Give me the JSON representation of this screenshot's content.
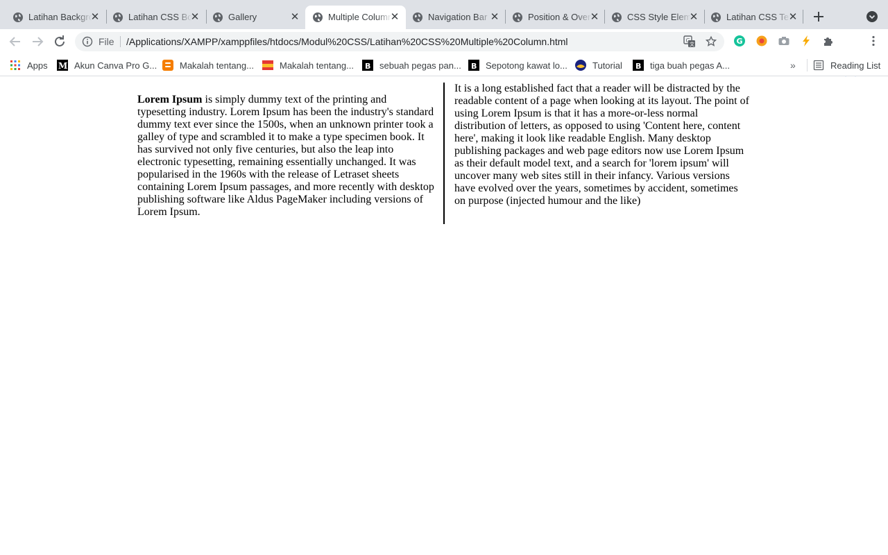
{
  "tabs": [
    {
      "title": "Latihan Background",
      "active": false
    },
    {
      "title": "Latihan CSS Border",
      "active": false
    },
    {
      "title": "Gallery",
      "active": false
    },
    {
      "title": "Multiple Column",
      "active": true
    },
    {
      "title": "Navigation Bar",
      "active": false
    },
    {
      "title": "Position & Overflow",
      "active": false
    },
    {
      "title": "CSS Style Element",
      "active": false
    },
    {
      "title": "Latihan CSS Text",
      "active": false
    }
  ],
  "omnibox": {
    "scheme_label": "File",
    "url": "/Applications/XAMPP/xamppfiles/htdocs/Modul%20CSS/Latihan%20CSS%20Multiple%20Column.html"
  },
  "bookmarks": {
    "items": [
      {
        "label": "Apps"
      },
      {
        "label": "Akun Canva Pro G..."
      },
      {
        "label": "Makalah tentang..."
      },
      {
        "label": "Makalah tentang..."
      },
      {
        "label": "sebuah pegas pan..."
      },
      {
        "label": "Sepotong kawat lo..."
      },
      {
        "label": "Tutorial"
      },
      {
        "label": "tiga buah pegas A..."
      }
    ],
    "reading_list": "Reading List"
  },
  "content": {
    "col1_bold": "Lorem Ipsum",
    "col1_text": " is simply dummy text of the printing and typesetting industry. Lorem Ipsum has been the industry's standard dummy text ever since the 1500s, when an unknown printer took a galley of type and scrambled it to make a type specimen book. It has survived not only five centuries, but also the leap into electronic typesetting, remaining essentially unchanged. It was popularised in the 1960s with the release of Letraset sheets containing Lorem Ipsum passages, and more recently with desktop publishing software like Aldus PageMaker including versions of Lorem Ipsum.",
    "col2_text": "It is a long established fact that a reader will be distracted by the readable content of a page when looking at its layout. The point of using Lorem Ipsum is that it has a more-or-less normal distribution of letters, as opposed to using 'Content here, content here', making it look like readable English. Many desktop publishing packages and web page editors now use Lorem Ipsum as their default model text, and a search for 'lorem ipsum' will uncover many web sites still in their infancy. Various versions have evolved over the years, sometimes by accident, sometimes on purpose (injected humour and the like)"
  }
}
